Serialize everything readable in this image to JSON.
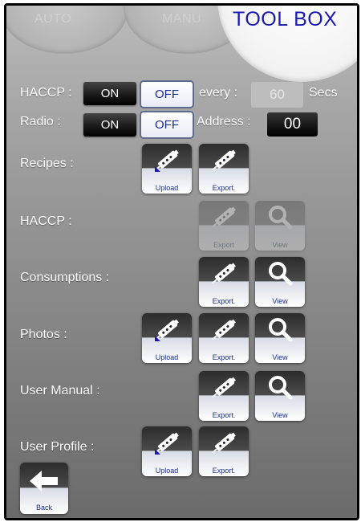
{
  "tabs": {
    "auto": "AUTO",
    "manu": "MANU"
  },
  "title": "TOOL BOX",
  "settings": {
    "haccp_label": "HACCP :",
    "haccp_on": "ON",
    "haccp_off": "OFF",
    "every_label": "every :",
    "every_value": "60",
    "secs_label": "Secs",
    "radio_label": "Radio :",
    "radio_on": "ON",
    "radio_off": "OFF",
    "address_label": "Address :",
    "address_value": "00"
  },
  "rows": {
    "recipes": {
      "label": "Recipes :",
      "upload": "Upload",
      "export": "Export."
    },
    "haccp": {
      "label": "HACCP :",
      "export": "Export",
      "view": "View"
    },
    "consumptions": {
      "label": "Consumptions :",
      "export": "Export.",
      "view": "View"
    },
    "photos": {
      "label": "Photos :",
      "upload": "Upload",
      "export": "Export.",
      "view": "View"
    },
    "user_manual": {
      "label": "User Manual :",
      "export": "Export.",
      "view": "View"
    },
    "user_profile": {
      "label": "User Profile :",
      "upload": "Upload",
      "export": "Export."
    }
  },
  "back_label": "Back",
  "colors": {
    "title": "#1a1ab0",
    "caption": "#1b2f8c"
  },
  "icons": {
    "upload": "upload-icon",
    "export": "export-icon",
    "view": "magnifier-icon",
    "back": "back-arrow-icon"
  }
}
